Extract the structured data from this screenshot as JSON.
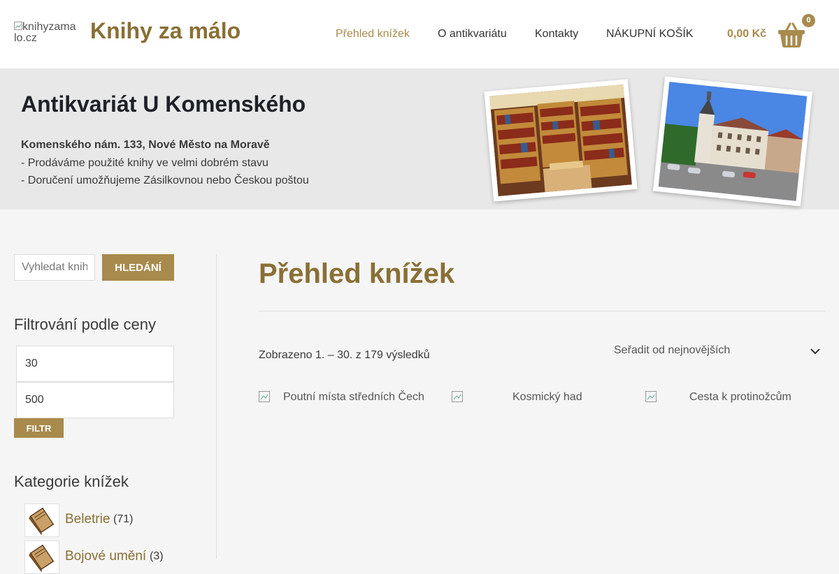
{
  "header": {
    "logo_alt": "knihyzamalo.cz",
    "site_title": "Knihy za málo",
    "nav": [
      {
        "label": "Přehled knížek",
        "active": true
      },
      {
        "label": "O antikvariátu",
        "active": false
      },
      {
        "label": "Kontakty",
        "active": false
      },
      {
        "label": "NÁKUPNÍ KOŠÍK",
        "active": false
      }
    ],
    "cart_total": "0,00 Kč",
    "cart_count": "0"
  },
  "banner": {
    "title": "Antikvariát U Komenského",
    "address": "Komenského nám. 133, Nové Město na Moravě",
    "lines": [
      "- Prodáváme použité knihy ve velmi dobrém stavu",
      "- Doručení umožňujeme Zásilkovnou nebo Českou poštou"
    ]
  },
  "sidebar": {
    "search_placeholder": "Vyhledat knihy…",
    "search_button": "HLEDÁNÍ",
    "price_filter_title": "Filtrování podle ceny",
    "price_min": "30",
    "price_max": "500",
    "filter_button": "FILTR",
    "categories_title": "Kategorie knížek",
    "categories": [
      {
        "name": "Beletrie",
        "count": "(71)"
      },
      {
        "name": "Bojové umění",
        "count": "(3)"
      }
    ]
  },
  "main": {
    "title": "Přehled knížek",
    "result_count": "Zobrazeno 1. – 30. z 179 výsledků",
    "sort_selected": "Seřadit od nejnovějších",
    "products": [
      {
        "alt": "Poutní místa středních Čech"
      },
      {
        "alt": "Kosmický had"
      },
      {
        "alt": "Cesta k protinožcům"
      }
    ]
  },
  "colors": {
    "accent": "#a88a4d",
    "title_brown": "#8a6f35",
    "banner_bg": "#e8e8e8",
    "page_bg": "#f5f5f5"
  },
  "icons": [
    "broken-image-icon",
    "shopping-basket-icon",
    "chevron-down-icon",
    "book-icon"
  ]
}
